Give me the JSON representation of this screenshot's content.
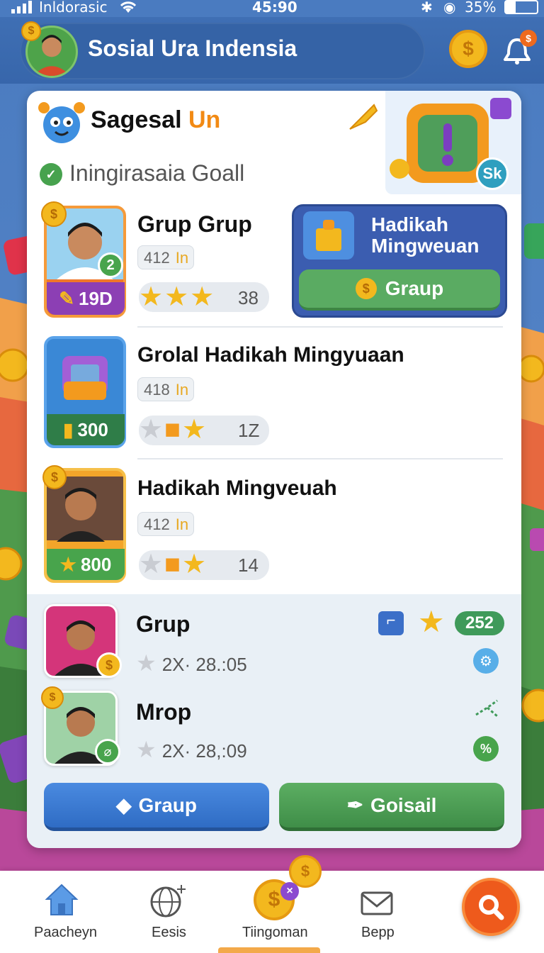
{
  "status_bar": {
    "carrier": "Inldorasic",
    "time": "45:90",
    "battery": "35%"
  },
  "header": {
    "title": "Sosial Ura Indensia",
    "notification_badge": "$"
  },
  "card": {
    "title_prefix": "Sagesal",
    "title_highlight": "Un",
    "subtitle": "Iningirasaia Goall",
    "side_badge": "Sk"
  },
  "feature": {
    "title_line1": "Hadikah",
    "title_line2": "Mingweuan",
    "button_label": "Graup"
  },
  "groups": [
    {
      "title": "Grup Grup",
      "chip_value": "412",
      "chip_unit": "In",
      "badge_value": "19D",
      "level": "2",
      "count": "38"
    },
    {
      "title": "Grolal Hadikah Mingyuaan",
      "chip_value": "418",
      "chip_unit": "In",
      "badge_value": "300",
      "count": "1Z"
    },
    {
      "title": "Hadikah Mingveuah",
      "chip_value": "412",
      "chip_unit": "In",
      "badge_value": "800",
      "count": "14"
    }
  ],
  "members": [
    {
      "name": "Grup",
      "meta": "2X· 28.:05",
      "score": "252"
    },
    {
      "name": "Mrop",
      "meta": "2X· 28,:09"
    }
  ],
  "actions": {
    "primary": "Graup",
    "secondary": "Goisail"
  },
  "nav": {
    "items": [
      "Paacheyn",
      "Eesis",
      "Tiingoman",
      "Bepp"
    ]
  },
  "colors": {
    "brand_blue": "#3d6db0",
    "accent_orange": "#f28a14",
    "green": "#4a9a58",
    "button_blue": "#3d7cd0"
  }
}
